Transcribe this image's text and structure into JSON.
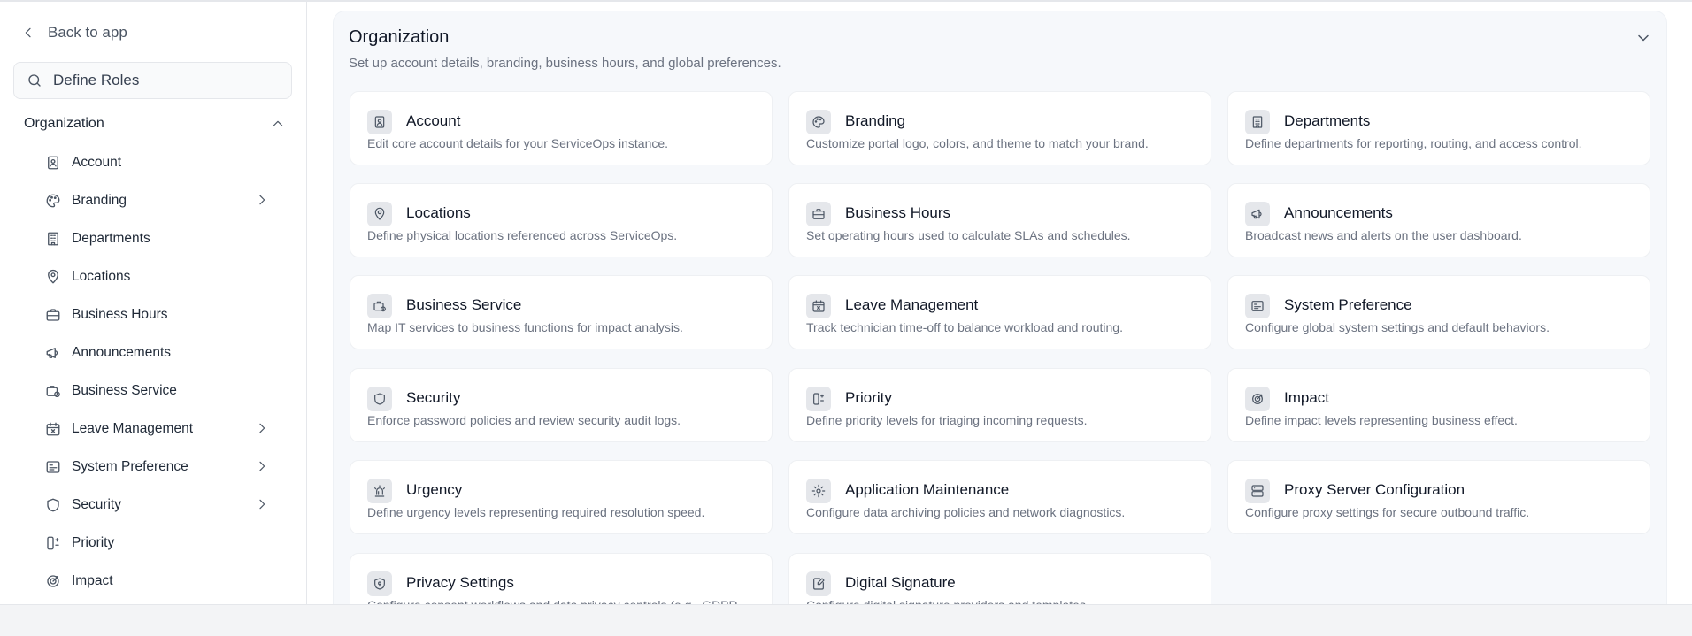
{
  "sidebar": {
    "back_label": "Back to app",
    "search_value": "Define Roles",
    "section_title": "Organization",
    "items": [
      {
        "label": "Account",
        "icon": "account-icon",
        "has_children": false
      },
      {
        "label": "Branding",
        "icon": "palette-icon",
        "has_children": true
      },
      {
        "label": "Departments",
        "icon": "building-icon",
        "has_children": false
      },
      {
        "label": "Locations",
        "icon": "map-pin-icon",
        "has_children": false
      },
      {
        "label": "Business Hours",
        "icon": "briefcase-icon",
        "has_children": false
      },
      {
        "label": "Announcements",
        "icon": "megaphone-icon",
        "has_children": false
      },
      {
        "label": "Business Service",
        "icon": "business-service-icon",
        "has_children": false
      },
      {
        "label": "Leave Management",
        "icon": "calendar-x-icon",
        "has_children": true
      },
      {
        "label": "System Preference",
        "icon": "system-preference-icon",
        "has_children": true
      },
      {
        "label": "Security",
        "icon": "shield-icon",
        "has_children": true
      },
      {
        "label": "Priority",
        "icon": "priority-icon",
        "has_children": false
      },
      {
        "label": "Impact",
        "icon": "target-icon",
        "has_children": false
      }
    ]
  },
  "panel": {
    "title": "Organization",
    "subtitle": "Set up account details, branding, business hours, and global preferences."
  },
  "cards": [
    {
      "title": "Account",
      "desc": "Edit core account details for your ServiceOps instance.",
      "icon": "account-icon"
    },
    {
      "title": "Branding",
      "desc": "Customize portal logo, colors, and theme to match your brand.",
      "icon": "palette-icon"
    },
    {
      "title": "Departments",
      "desc": "Define departments for reporting, routing, and access control.",
      "icon": "building-icon"
    },
    {
      "title": "Locations",
      "desc": "Define physical locations referenced across ServiceOps.",
      "icon": "map-pin-icon"
    },
    {
      "title": "Business Hours",
      "desc": "Set operating hours used to calculate SLAs and schedules.",
      "icon": "briefcase-icon"
    },
    {
      "title": "Announcements",
      "desc": "Broadcast news and alerts on the user dashboard.",
      "icon": "megaphone-icon"
    },
    {
      "title": "Business Service",
      "desc": "Map IT services to business functions for impact analysis.",
      "icon": "business-service-icon"
    },
    {
      "title": "Leave Management",
      "desc": "Track technician time-off to balance workload and routing.",
      "icon": "calendar-x-icon"
    },
    {
      "title": "System Preference",
      "desc": "Configure global system settings and default behaviors.",
      "icon": "system-preference-icon"
    },
    {
      "title": "Security",
      "desc": "Enforce password policies and review security audit logs.",
      "icon": "shield-icon"
    },
    {
      "title": "Priority",
      "desc": "Define priority levels for triaging incoming requests.",
      "icon": "priority-icon"
    },
    {
      "title": "Impact",
      "desc": "Define impact levels representing business effect.",
      "icon": "target-icon"
    },
    {
      "title": "Urgency",
      "desc": "Define urgency levels representing required resolution speed.",
      "icon": "siren-icon"
    },
    {
      "title": "Application Maintenance",
      "desc": "Configure data archiving policies and network diagnostics.",
      "icon": "cog-icon"
    },
    {
      "title": "Proxy Server Configuration",
      "desc": "Configure proxy settings for secure outbound traffic.",
      "icon": "server-icon"
    },
    {
      "title": "Privacy Settings",
      "desc": "Configure consent workflows and data privacy controls (e.g., GDPR",
      "icon": "privacy-shield-icon"
    },
    {
      "title": "Digital Signature",
      "desc": "Configure digital signature providers and templates.",
      "icon": "signature-icon"
    }
  ]
}
